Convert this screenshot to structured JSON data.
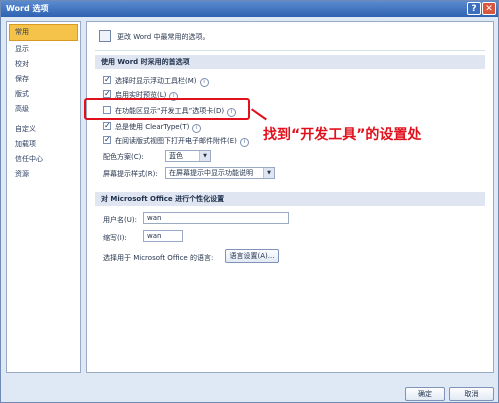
{
  "window": {
    "title": "Word 选项",
    "help_label": "?",
    "close_label": "✕"
  },
  "sidebar": {
    "items": [
      {
        "label": "常用",
        "selected": true
      },
      {
        "label": "显示"
      },
      {
        "label": "校对"
      },
      {
        "label": "保存"
      },
      {
        "label": "版式"
      },
      {
        "label": "高级"
      },
      {
        "label": "自定义"
      },
      {
        "label": "加载项"
      },
      {
        "label": "信任中心"
      },
      {
        "label": "资源"
      }
    ]
  },
  "header": {
    "text": "更改 Word 中最常用的选项。"
  },
  "section1": {
    "title": "使用 Word 时采用的首选项",
    "options": [
      {
        "label": "选择时显示浮动工具栏(M)",
        "checked": true
      },
      {
        "label": "启用实时预览(L)",
        "checked": true
      },
      {
        "label": "在功能区显示“开发工具”选项卡(D)",
        "checked": false
      },
      {
        "label": "总是使用 ClearType(T)",
        "checked": true
      },
      {
        "label": "在阅读版式视图下打开电子邮件附件(E)",
        "checked": true
      }
    ],
    "color_scheme_label": "配色方案(C):",
    "color_scheme_value": "蓝色",
    "screentip_label": "屏幕提示样式(R):",
    "screentip_value": "在屏幕提示中显示功能说明"
  },
  "section2": {
    "title": "对 Microsoft Office 进行个性化设置",
    "username_label": "用户名(U):",
    "username_value": "wan",
    "initials_label": "缩写(I):",
    "initials_value": "wan",
    "language_label": "选择用于 Microsoft Office 的语言:",
    "language_button": "语言设置(A)..."
  },
  "annotation": {
    "text": "找到“开发工具”的设置处",
    "color": "#e0111d"
  },
  "footer": {
    "ok_label": "确定",
    "cancel_label": "取消"
  }
}
